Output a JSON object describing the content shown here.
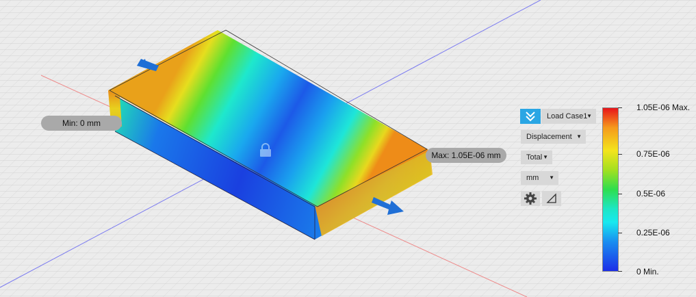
{
  "probes": {
    "min_label": "Min: 0 mm",
    "max_label": "Max: 1.05E-06 mm"
  },
  "controls": {
    "load_case": "Load Case1",
    "result_type": "Displacement",
    "component": "Total",
    "units": "mm",
    "icons": [
      "double-check-icon",
      "gear-icon",
      "deformation-scale-icon"
    ]
  },
  "legend": {
    "labels": [
      "1.05E-06 Max.",
      "0.75E-06",
      "0.5E-06",
      "0.25E-06",
      "0 Min."
    ],
    "colors": [
      "#e8151b",
      "#f59a1c",
      "#f4e41c",
      "#a3e020",
      "#2ede4f",
      "#1de6c6",
      "#18e9ef",
      "#198ef0",
      "#1c2ee8"
    ]
  },
  "colors": {
    "accent": "#2aa6e4",
    "load_arrow": "#1f6fd6",
    "background": "#ececec"
  }
}
